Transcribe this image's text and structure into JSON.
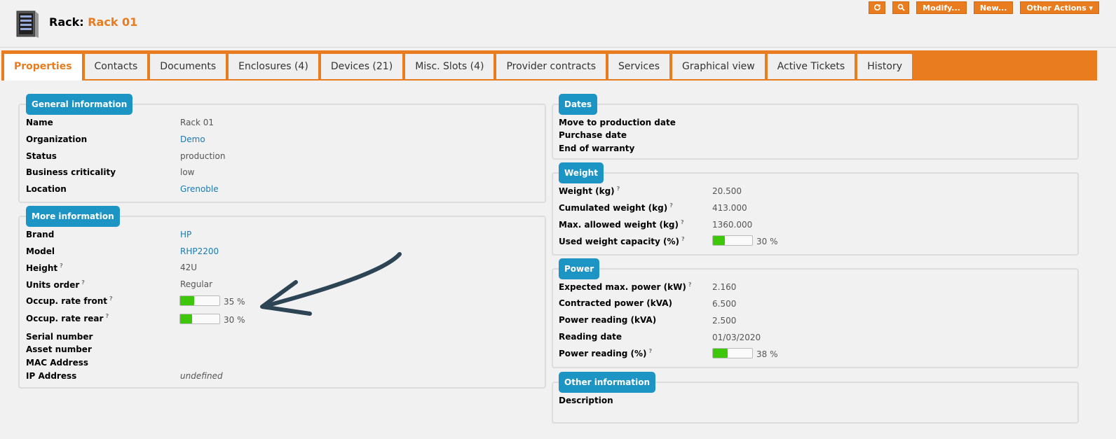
{
  "header": {
    "class_label": "Rack:",
    "object_name": "Rack 01"
  },
  "actions": {
    "refresh_icon": "refresh-icon",
    "search_icon": "search-icon",
    "modify": "Modify...",
    "new": "New...",
    "other": "Other Actions ▾"
  },
  "tabs": [
    {
      "label": "Properties"
    },
    {
      "label": "Contacts"
    },
    {
      "label": "Documents"
    },
    {
      "label": "Enclosures (4)"
    },
    {
      "label": "Devices (21)"
    },
    {
      "label": "Misc. Slots (4)"
    },
    {
      "label": "Provider contracts"
    },
    {
      "label": "Services"
    },
    {
      "label": "Graphical view"
    },
    {
      "label": "Active Tickets"
    },
    {
      "label": "History"
    }
  ],
  "general": {
    "title": "General information",
    "name_label": "Name",
    "name": "Rack 01",
    "org_label": "Organization",
    "org": "Demo",
    "status_label": "Status",
    "status": "production",
    "crit_label": "Business criticality",
    "crit": "low",
    "location_label": "Location",
    "location": "Grenoble"
  },
  "more": {
    "title": "More information",
    "brand_label": "Brand",
    "brand": "HP",
    "model_label": "Model",
    "model": "RHP2200",
    "height_label": "Height",
    "height": "42U",
    "units_label": "Units order",
    "units": "Regular",
    "front_label": "Occup. rate front",
    "front_pct": 35,
    "front_text": "35 %",
    "rear_label": "Occup. rate rear",
    "rear_pct": 30,
    "rear_text": "30 %",
    "serial_label": "Serial number",
    "asset_label": "Asset number",
    "mac_label": "MAC Address",
    "ip_label": "IP Address",
    "ip": "undefined"
  },
  "dates": {
    "title": "Dates",
    "move_label": "Move to production date",
    "purchase_label": "Purchase date",
    "warranty_label": "End of warranty"
  },
  "weight": {
    "title": "Weight",
    "w_label": "Weight (kg)",
    "w": "20.500",
    "cum_label": "Cumulated weight (kg)",
    "cum": "413.000",
    "max_label": "Max. allowed weight (kg)",
    "max": "1360.000",
    "used_label": "Used weight capacity (%)",
    "used_pct": 30,
    "used_text": "30 %"
  },
  "power": {
    "title": "Power",
    "exp_label": "Expected max. power (kW)",
    "exp": "2.160",
    "contract_label": "Contracted power (kVA)",
    "contract": "6.500",
    "reading_label": "Power reading (kVA)",
    "reading": "2.500",
    "date_label": "Reading date",
    "date": "01/03/2020",
    "pct_label": "Power reading (%)",
    "pct": 38,
    "pct_text": "38 %"
  },
  "other": {
    "title": "Other information",
    "desc_label": "Description"
  },
  "help_mark": "?",
  "colors": {
    "accent": "#e87c1e",
    "legend": "#1c94c4",
    "link": "#1b7bb0",
    "bar_fill": "#3ec60a",
    "arrow": "#2d4454"
  }
}
